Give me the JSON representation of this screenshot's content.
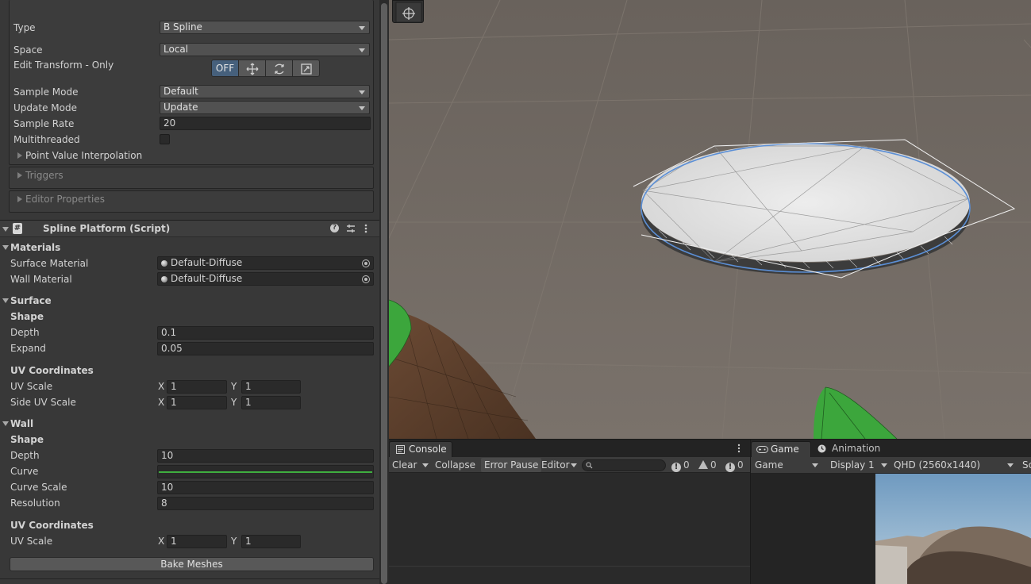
{
  "inspector": {
    "type": {
      "label": "Type",
      "value": "B Spline"
    },
    "space": {
      "label": "Space",
      "value": "Local"
    },
    "edit_transform": {
      "label": "Edit Transform - Only",
      "off_label": "OFF"
    },
    "sample_mode": {
      "label": "Sample Mode",
      "value": "Default"
    },
    "update_mode": {
      "label": "Update Mode",
      "value": "Update"
    },
    "sample_rate": {
      "label": "Sample Rate",
      "value": "20"
    },
    "multithreaded": {
      "label": "Multithreaded",
      "checked": false
    },
    "point_value_interpolation": "Point Value Interpolation",
    "triggers": "Triggers",
    "editor_properties": "Editor Properties",
    "component": {
      "title": "Spline Platform (Script)",
      "materials": {
        "header": "Materials",
        "surface_material": {
          "label": "Surface Material",
          "value": "Default-Diffuse"
        },
        "wall_material": {
          "label": "Wall Material",
          "value": "Default-Diffuse"
        }
      },
      "surface": {
        "header": "Surface",
        "shape_header": "Shape",
        "depth": {
          "label": "Depth",
          "value": "0.1"
        },
        "expand": {
          "label": "Expand",
          "value": "0.05"
        },
        "uv_header": "UV Coordinates",
        "uv_scale": {
          "label": "UV Scale",
          "x_label": "X",
          "x": "1",
          "y_label": "Y",
          "y": "1"
        },
        "side_uv_scale": {
          "label": "Side UV Scale",
          "x_label": "X",
          "x": "1",
          "y_label": "Y",
          "y": "1"
        }
      },
      "wall": {
        "header": "Wall",
        "shape_header": "Shape",
        "depth": {
          "label": "Depth",
          "value": "10"
        },
        "curve": {
          "label": "Curve",
          "color": "#3fae3f"
        },
        "curve_scale": {
          "label": "Curve Scale",
          "value": "10"
        },
        "resolution": {
          "label": "Resolution",
          "value": "8"
        },
        "uv_header": "UV Coordinates",
        "uv_scale": {
          "label": "UV Scale",
          "x_label": "X",
          "x": "1",
          "y_label": "Y",
          "y": "1"
        }
      },
      "bake_button": "Bake Meshes"
    }
  },
  "console": {
    "tab": "Console",
    "clear": "Clear",
    "collapse": "Collapse",
    "error_pause": "Error Pause",
    "editor": "Editor",
    "log_count": "0",
    "warning_count": "0",
    "error_count": "0"
  },
  "game": {
    "tab_game": "Game",
    "tab_animation": "Animation",
    "mode": "Game",
    "display": "Display 1",
    "resolution": "QHD (2560x1440)",
    "cut_label": "Sc"
  },
  "colors": {
    "accent_active": "#46607c",
    "scene_ground": "#706963",
    "selection_outline": "#5b8fd6",
    "foliage_green": "#3ca63c"
  }
}
